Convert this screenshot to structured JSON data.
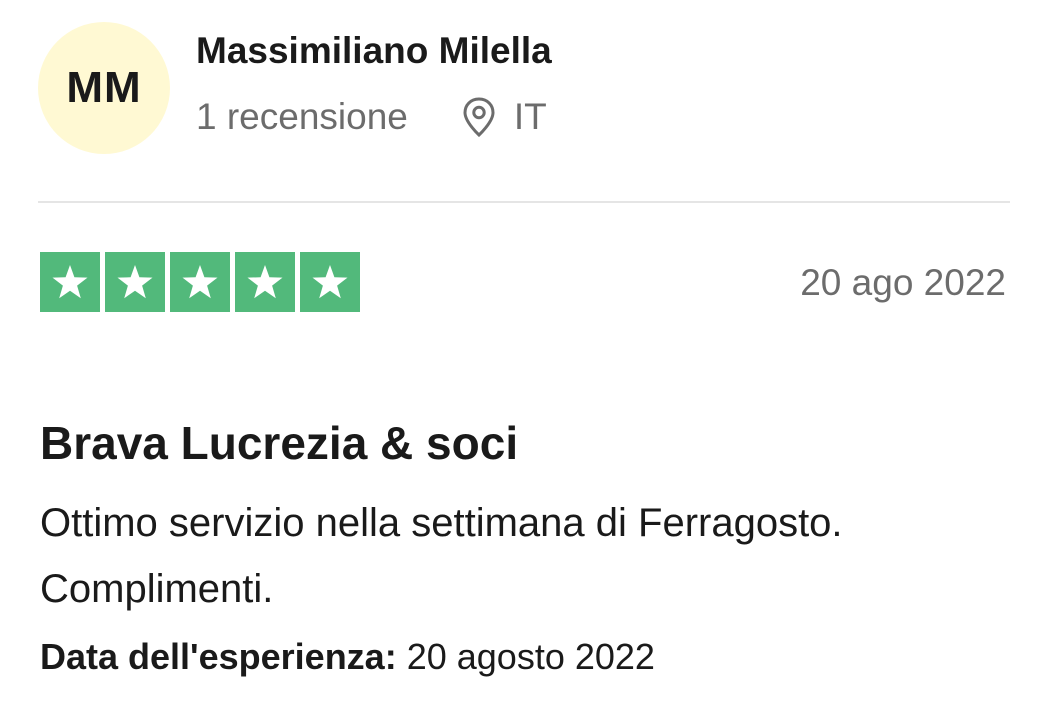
{
  "reviewer": {
    "initials": "MM",
    "name": "Massimiliano Milella",
    "review_count": "1 recensione",
    "country": "IT",
    "avatar_color": "#FFF9D3",
    "location_icon": "map-pin-icon"
  },
  "review": {
    "rating": 5,
    "rating_max": 5,
    "star_color": "#52B97B",
    "star_icon": "star-icon",
    "date": "20 ago 2022",
    "title": "Brava Lucrezia & soci",
    "body": "Ottimo servizio nella settimana di Ferragosto. Complimenti.",
    "experience_label": "Data dell'esperienza:",
    "experience_date": "20 agosto 2022"
  }
}
